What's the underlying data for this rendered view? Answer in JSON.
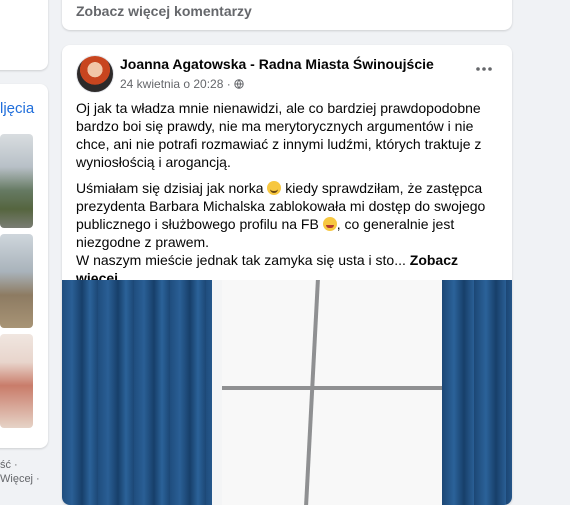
{
  "previous_post": {
    "more_comments_label": "Zobacz więcej komentarzy"
  },
  "sidebar": {
    "link_text": "ljęcia",
    "footer_lines": [
      "ść ·",
      "Więcej ·"
    ]
  },
  "post": {
    "author": "Joanna Agatowska - Radna Miasta Świnoujście",
    "timestamp": "24 kwietnia o 20:28 ·",
    "privacy_icon": "globe-icon",
    "options_icon": "more-dots-icon",
    "paragraph1": "Oj jak ta władza mnie nienawidzi, ale co bardziej prawdopodobne bardzo boi się prawdy, nie ma merytorycznych argumentów i nie chce, ani nie potrafi rozmawiać z innymi ludźmi, których traktuje z wyniosłością i arogancją.",
    "paragraph2_a": "Uśmiałam się dzisiaj jak norka ",
    "paragraph2_b": " kiedy sprawdziłam, że zastępca prezydenta Barbara Michalska zablokowała mi dostęp do  swojego publicznego i  służbowego profilu na FB ",
    "paragraph2_c": ", co generalnie jest niezgodne z prawem.",
    "paragraph3": "W naszym mieście jednak tak zamyka się usta i sto... ",
    "see_more_label": "Zobacz więcej"
  },
  "colors": {
    "background": "#f0f2f5",
    "card": "#ffffff",
    "secondary_text": "#65676b",
    "link": "#216fdb"
  }
}
